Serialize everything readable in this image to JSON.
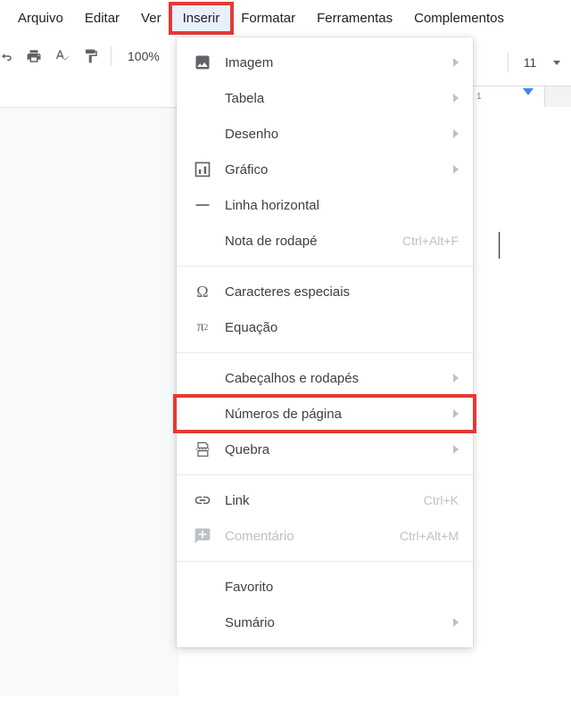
{
  "menubar": {
    "items": [
      {
        "label": "Arquivo"
      },
      {
        "label": "Editar"
      },
      {
        "label": "Ver"
      },
      {
        "label": "Inserir",
        "active": true
      },
      {
        "label": "Formatar"
      },
      {
        "label": "Ferramentas"
      },
      {
        "label": "Complementos"
      }
    ]
  },
  "toolbar": {
    "zoom": "100%",
    "font_size": "11"
  },
  "ruler": {
    "tick": "1"
  },
  "insert_menu": {
    "items": [
      {
        "label": "Imagem",
        "icon": "image",
        "submenu": true
      },
      {
        "label": "Tabela",
        "icon": "",
        "submenu": true
      },
      {
        "label": "Desenho",
        "icon": "",
        "submenu": true
      },
      {
        "label": "Gráfico",
        "icon": "chart",
        "submenu": true
      },
      {
        "label": "Linha horizontal",
        "icon": "hr"
      },
      {
        "label": "Nota de rodapé",
        "icon": "",
        "shortcut": "Ctrl+Alt+F"
      },
      {
        "sep": true
      },
      {
        "label": "Caracteres especiais",
        "icon": "omega"
      },
      {
        "label": "Equação",
        "icon": "pi"
      },
      {
        "sep": true
      },
      {
        "label": "Cabeçalhos e rodapés",
        "icon": "",
        "submenu": true
      },
      {
        "label": "Números de página",
        "icon": "",
        "submenu": true,
        "highlight": true
      },
      {
        "label": "Quebra",
        "icon": "break",
        "submenu": true
      },
      {
        "sep": true
      },
      {
        "label": "Link",
        "icon": "link",
        "shortcut": "Ctrl+K"
      },
      {
        "label": "Comentário",
        "icon": "comment",
        "shortcut": "Ctrl+Alt+M",
        "disabled": true
      },
      {
        "sep": true
      },
      {
        "label": "Favorito",
        "icon": ""
      },
      {
        "label": "Sumário",
        "icon": "",
        "submenu": true
      }
    ]
  }
}
